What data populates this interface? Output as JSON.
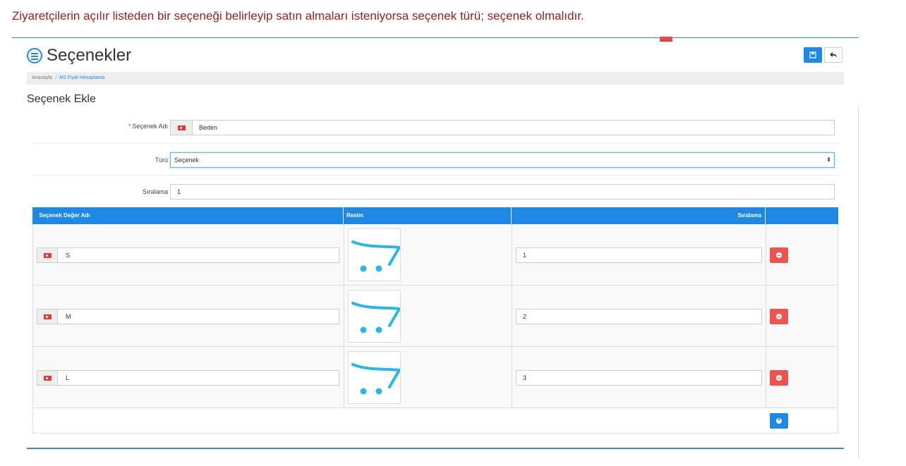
{
  "caption": "Ziyaretçilerin açılır listeden bir seçeneği belirleyip satın almaları isteniyorsa seçenek türü; seçenek olmalıdır.",
  "header": {
    "title": "Seçenekler",
    "icon": "options-list-icon"
  },
  "breadcrumb": {
    "home": "Anasayfa",
    "separator": "/",
    "current": "M2 Fiyat Hesaplama"
  },
  "section_title": "Seçenek Ekle",
  "form": {
    "name_label": "Seçenek Adı",
    "name_value": "Beden",
    "type_label": "Türü",
    "type_value": "Seçenek",
    "sort_label": "Sıralama",
    "sort_value": "1"
  },
  "table": {
    "headers": [
      "Seçenek Değer Adı",
      "Resim",
      "Sıralama"
    ],
    "rows": [
      {
        "value": "S",
        "sort": "1"
      },
      {
        "value": "M",
        "sort": "2"
      },
      {
        "value": "L",
        "sort": "3"
      }
    ]
  },
  "colors": {
    "accent": "#1e88e5",
    "danger": "#ef5350",
    "caption": "#9b1c1c",
    "thumb": "#29b6e8"
  }
}
